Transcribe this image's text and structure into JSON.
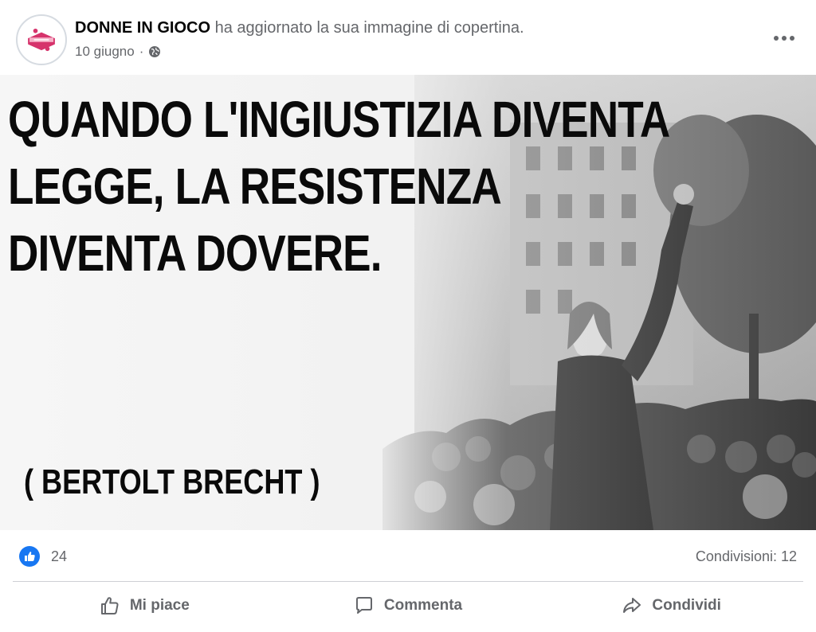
{
  "post": {
    "page_name": "DONNE IN GIOCO",
    "action_text": "ha aggiornato la sua immagine di copertina.",
    "date": "10 giugno",
    "separator": "·",
    "privacy_icon": "globe-icon",
    "more_icon": "more-horizontal-icon"
  },
  "cover": {
    "quote_lines": [
      "QUANDO L'INGIUSTIZIA DIVENTA",
      "LEGGE, LA RESISTENZA",
      "DIVENTA DOVERE."
    ],
    "author": "( BERTOLT BRECHT )"
  },
  "reactions": {
    "like_icon": "like-reaction-icon",
    "like_count": "24",
    "shares": "Condivisioni: 12"
  },
  "actions": {
    "like_label": "Mi piace",
    "comment_label": "Commenta",
    "share_label": "Condividi"
  },
  "colors": {
    "text_primary": "#050505",
    "text_secondary": "#65676b",
    "like_blue": "#1877f2",
    "divider": "#ced0d4",
    "logo_pink": "#d6336c"
  }
}
